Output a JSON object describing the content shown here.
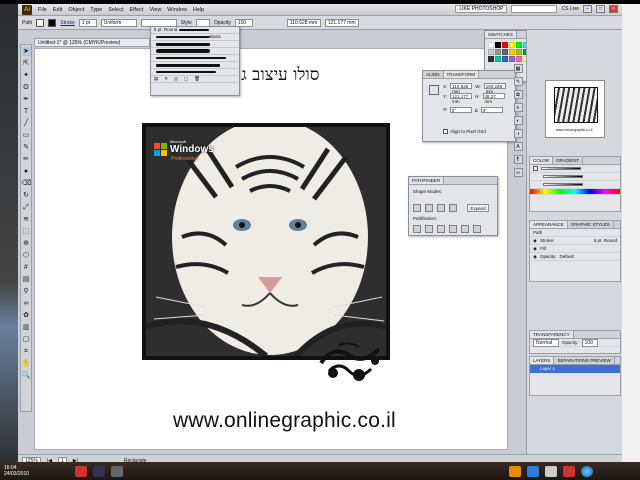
{
  "menubar": {
    "app_logo": "Ai",
    "items": [
      "File",
      "Edit",
      "Object",
      "Type",
      "Select",
      "Effect",
      "View",
      "Window",
      "Help"
    ],
    "workspace": "LIKE PHOTOSHOP",
    "search_placeholder": "",
    "cs_live": "CS Live"
  },
  "controlbar": {
    "path_label": "Path",
    "stroke_label": "Stroke",
    "stroke_value": "1 pt",
    "brush_label": "Uniform",
    "style_label": "Style",
    "opacity_label": "Opacity",
    "opacity_value": "100",
    "x_value": "110.528 mm",
    "y_value": "121.177 mm"
  },
  "document": {
    "tab_label": "Untitled-1* @ 125% (CMYK/Preview)",
    "hebrew_title": "סולו עיצוב גרפי לימוד",
    "url_text": "www.onlinegraphic.co.il",
    "xp_badge": {
      "microsoft": "Microsoft",
      "name": "Windows",
      "edition": "Professional"
    }
  },
  "brush_panel": {
    "rows": [
      "5 pt. Round",
      "Basic",
      "",
      "",
      ""
    ]
  },
  "transform_panel": {
    "tabs": [
      "ALIGN",
      "TRANSFORM"
    ],
    "x_label": "X:",
    "x_value": "110.528 mm",
    "y_label": "Y:",
    "y_value": "121.177 mm",
    "w_label": "W:",
    "w_value": "100.226 mm",
    "h_label": "H:",
    "h_value": "38.27 mm",
    "rotate_value": "0°",
    "shear_value": "0°",
    "align_pixel_grid": "Align to Pixel Grid"
  },
  "pathfinder_panel": {
    "tab": "PATHFINDER",
    "shape_modes": "Shape Modes:",
    "pathfinders": "Pathfinders:",
    "expand_label": "Expand"
  },
  "swatches_panel": {
    "tab": "SWATCHES",
    "colors": [
      "#ffffff",
      "#000000",
      "#ff0000",
      "#ffff00",
      "#00ff00",
      "#00ffff",
      "#0000ff",
      "#ff00ff",
      "#ff6600",
      "#996633",
      "#cc0033",
      "#ff9999",
      "#cccccc",
      "#999999",
      "#666666",
      "#ffcc00",
      "#99cc00",
      "#009966",
      "#006699",
      "#663399",
      "#cc3399",
      "#ffcc99",
      "#cc9966",
      "#ff3366",
      "#333333",
      "#00cc99",
      "#3366cc",
      "#9966cc",
      "#ff6699",
      "#ffff99",
      "#99ff99",
      "#99ccff",
      "#cc99ff",
      "#ff99cc",
      "#e0e0e0",
      "#b0b0b0"
    ]
  },
  "dock": {
    "navigator_url": "www.onlinegraphic.co.il",
    "color_tabs": [
      "COLOR",
      "GRADIENT"
    ],
    "appearance_tabs": [
      "APPEARANCE",
      "GRAPHIC STYLES"
    ],
    "appearance_title": "Path",
    "stroke_row": "Stroke:",
    "stroke_value": "5 pt. Round",
    "fill_row": "Fill:",
    "opacity_row": "Opacity:",
    "opacity_value": "Default",
    "transparency_tab": "TRANSPARENCY",
    "blend_mode": "Normal",
    "opacity_label": "Opacity:",
    "opacity_percent": "100",
    "layers_tabs": [
      "LAYERS",
      "SEPARATIONS PREVIEW"
    ],
    "layer_name": "Layer 1"
  },
  "statusbar": {
    "zoom": "125%",
    "page": "1",
    "tool": "Rectangle"
  },
  "taskbar": {
    "time": "16:04",
    "date": "24/03/2010"
  },
  "tools": [
    "arrow-icon",
    "direct-select-icon",
    "magic-wand-icon",
    "lasso-icon",
    "pen-icon",
    "type-icon",
    "line-icon",
    "rectangle-icon",
    "paintbrush-icon",
    "pencil-icon",
    "blob-brush-icon",
    "eraser-icon",
    "rotate-icon",
    "scale-icon",
    "width-icon",
    "free-transform-icon",
    "shape-builder-icon",
    "perspective-icon",
    "mesh-icon",
    "gradient-icon",
    "eyedropper-icon",
    "blend-icon",
    "symbol-sprayer-icon",
    "column-graph-icon",
    "artboard-icon",
    "slice-icon",
    "hand-icon",
    "zoom-icon"
  ]
}
